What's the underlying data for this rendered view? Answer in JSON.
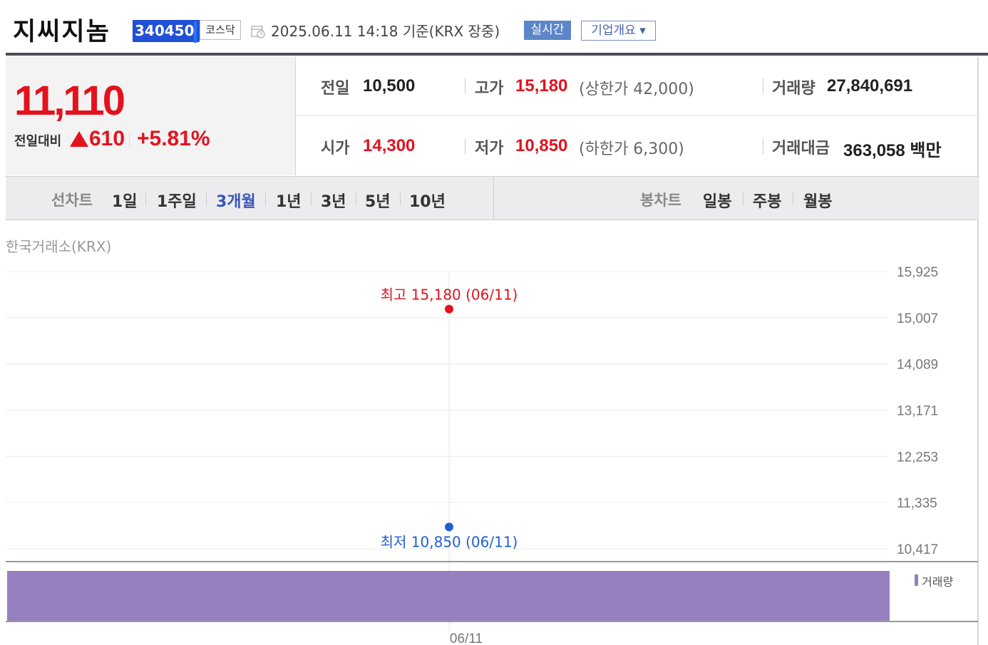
{
  "header": {
    "company_name": "지씨지놈",
    "code": "340450",
    "market": "코스닥",
    "datetime": "2025.06.11 14:18 기준(KRX 장중)",
    "realtime_label": "실시간",
    "company_info_label": "기업개요 ▾"
  },
  "price": {
    "current": "11,110",
    "change_label": "전일대비",
    "change_value": "610",
    "change_percent": "+5.81%"
  },
  "stats": {
    "prev_label": "전일",
    "prev_value": "10,500",
    "open_label": "시가",
    "open_value": "14,300",
    "high_label": "고가",
    "high_value": "15,180",
    "upper_limit": "(상한가 42,000)",
    "low_label": "저가",
    "low_value": "10,850",
    "lower_limit": "(하한가 6,300)",
    "volume_label": "거래량",
    "volume_value": "27,840,691",
    "amount_label": "거래대금",
    "amount_value": "363,058 백만"
  },
  "periods": {
    "line_title": "선차트",
    "line_items": [
      "1일",
      "1주일",
      "3개월",
      "1년",
      "3년",
      "5년",
      "10년"
    ],
    "selected": "3개월",
    "candle_title": "봉차트",
    "candle_items": [
      "일봉",
      "주봉",
      "월봉"
    ]
  },
  "chart": {
    "exchange": "한국거래소(KRX)",
    "volume_legend": "거래량",
    "high_note": "최고 15,180 (06/11)",
    "low_note": "최저 10,850 (06/11)"
  },
  "colors": {
    "up": "#e3121d",
    "down": "#1f5fd6",
    "volume": "#9680c0",
    "accent": "#3a55b9"
  },
  "chart_data": {
    "type": "line",
    "x": [
      "06/11"
    ],
    "series": [
      {
        "values": [
          11110
        ]
      }
    ],
    "high": {
      "x": "06/11",
      "y": 15180
    },
    "low": {
      "x": "06/11",
      "y": 10850
    },
    "y_ticks": [
      "15,925",
      "15,007",
      "14,089",
      "13,171",
      "12,253",
      "11,335",
      "10,417"
    ],
    "y_tick_values": [
      15925,
      15007,
      14089,
      13171,
      12253,
      11335,
      10417
    ],
    "volume": {
      "name": "거래량",
      "values": [
        27840691
      ]
    },
    "x_tick_labels": [
      "06/11"
    ],
    "grid": true
  }
}
